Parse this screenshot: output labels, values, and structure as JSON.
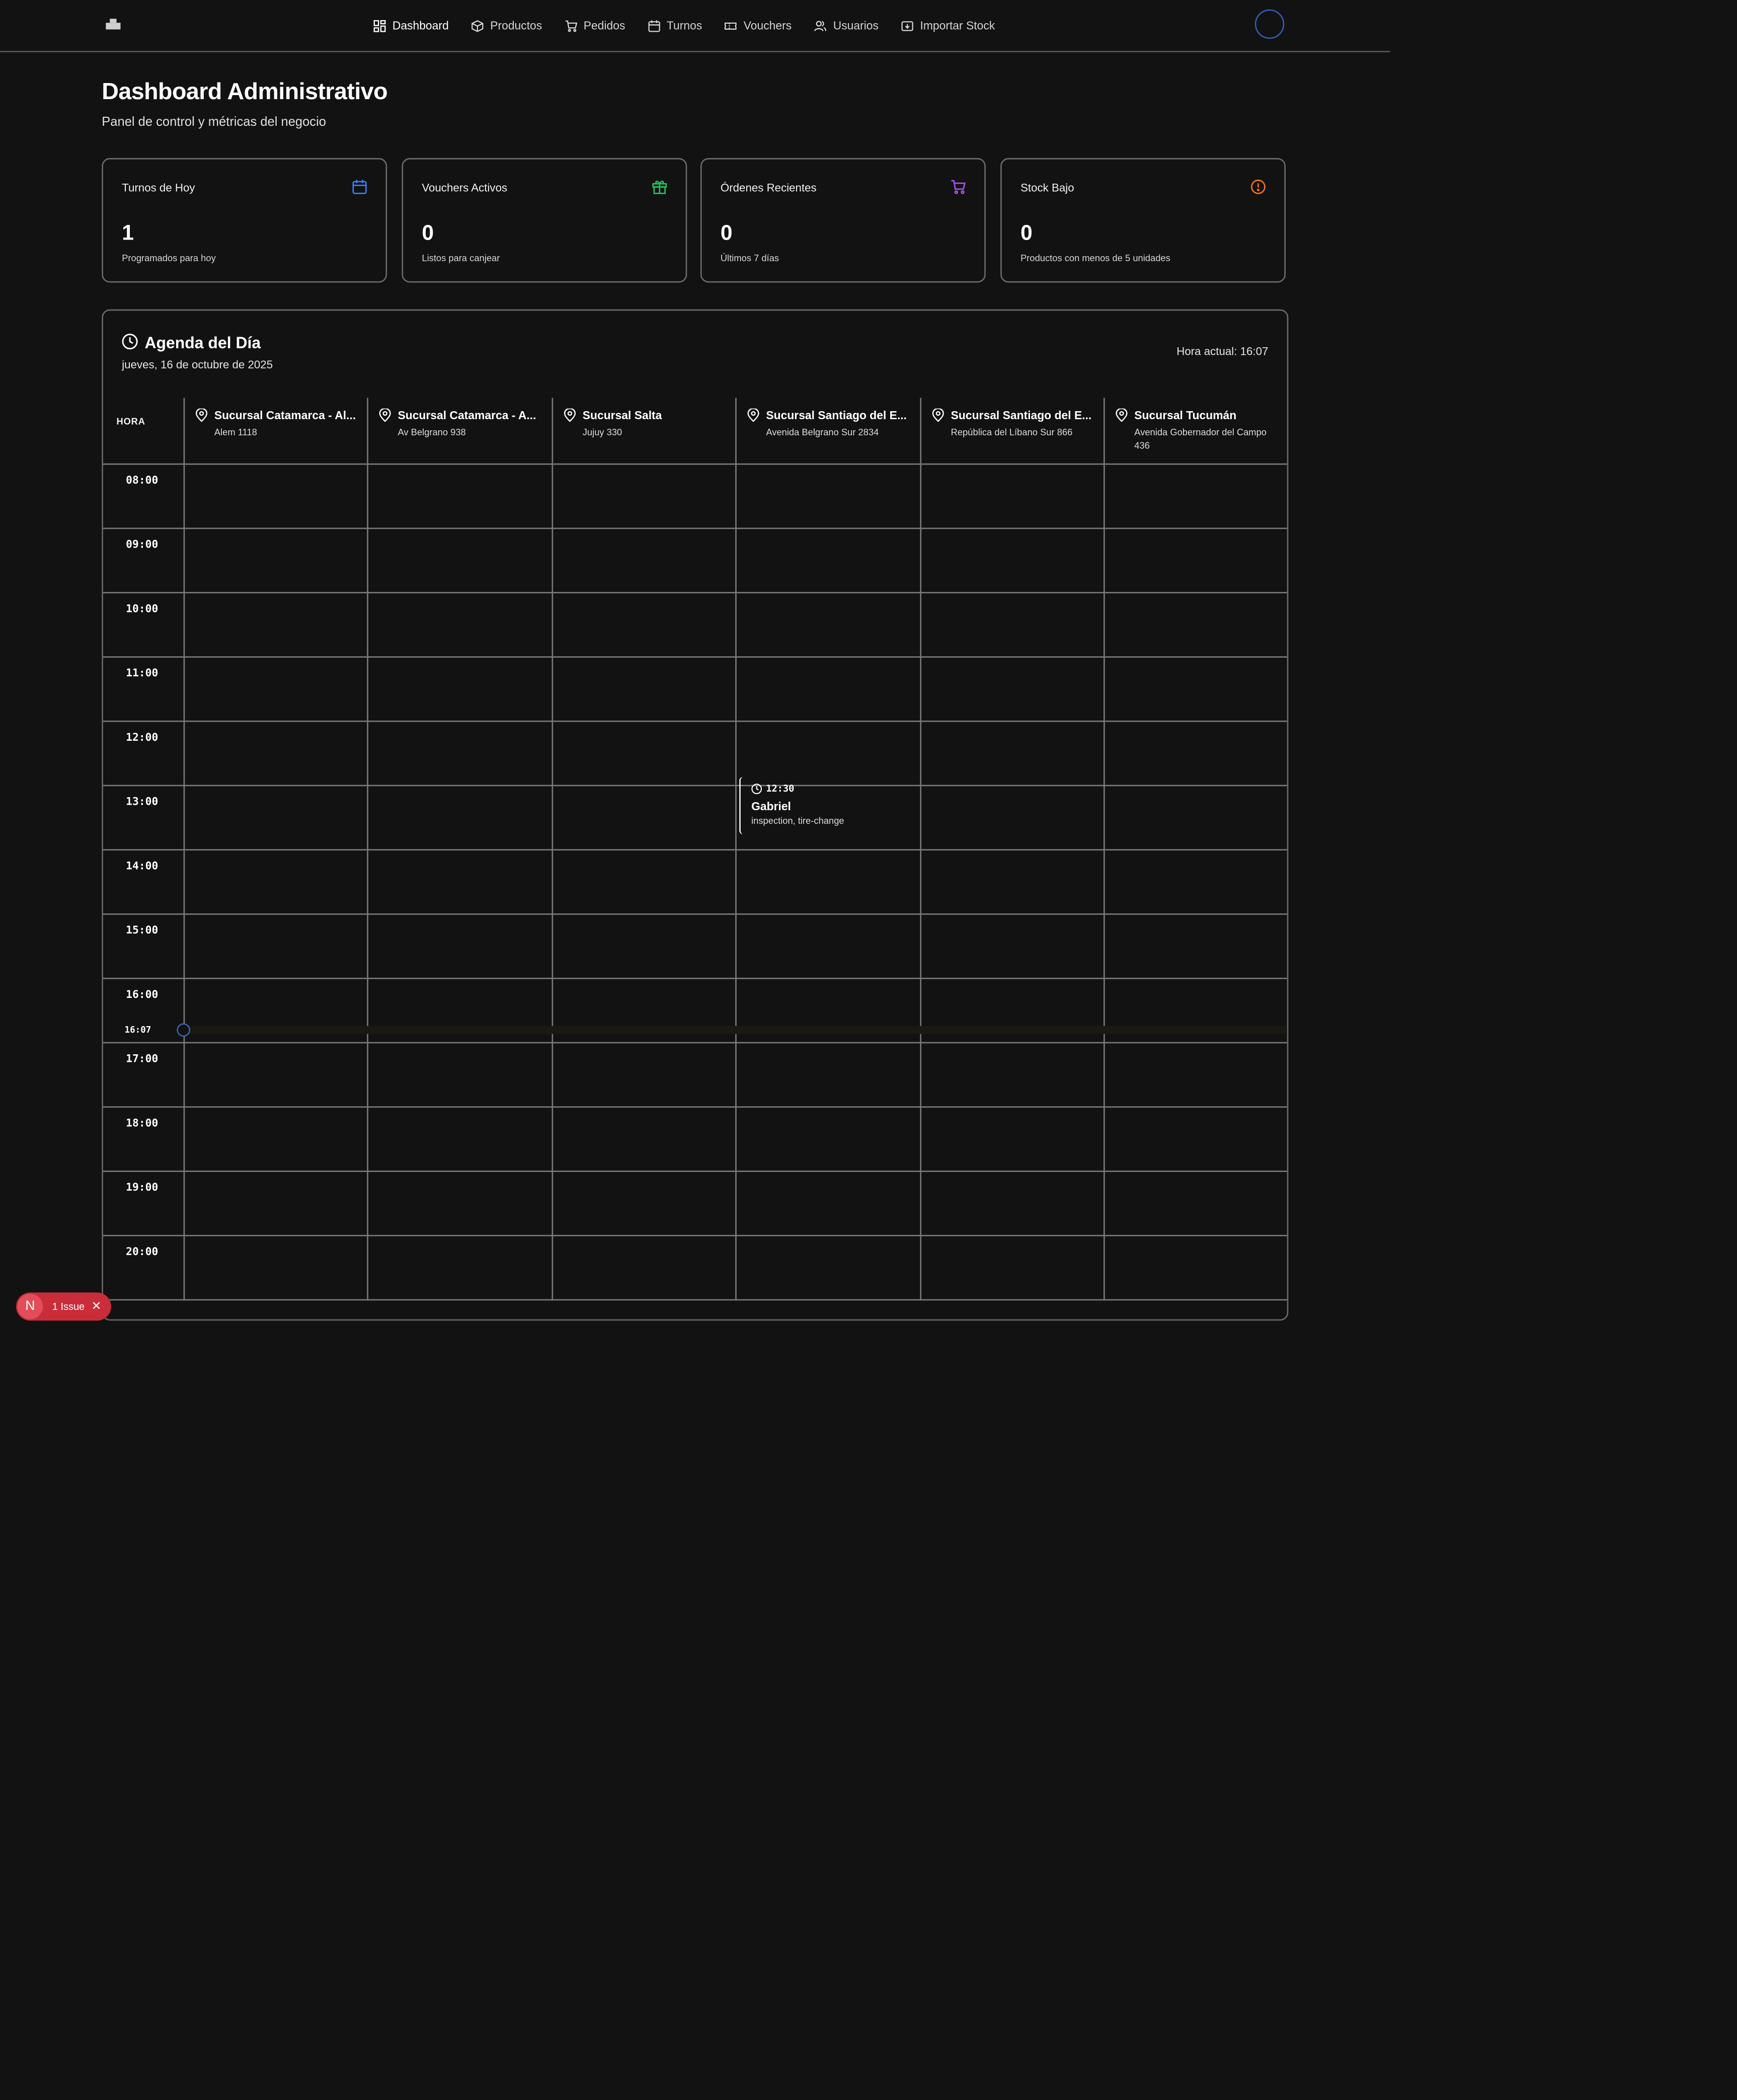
{
  "nav": {
    "items": [
      {
        "label": "Dashboard",
        "icon": "dashboard-icon",
        "active": true
      },
      {
        "label": "Productos",
        "icon": "box-icon"
      },
      {
        "label": "Pedidos",
        "icon": "cart-icon"
      },
      {
        "label": "Turnos",
        "icon": "calendar-icon"
      },
      {
        "label": "Vouchers",
        "icon": "ticket-icon"
      },
      {
        "label": "Usuarios",
        "icon": "users-icon"
      },
      {
        "label": "Importar Stock",
        "icon": "import-icon"
      }
    ]
  },
  "header": {
    "title": "Dashboard Administrativo",
    "subtitle": "Panel de control y métricas del negocio"
  },
  "cards": [
    {
      "title": "Turnos de Hoy",
      "value": "1",
      "desc": "Programados para hoy",
      "icon": "calendar-icon",
      "color": "#3b82f6"
    },
    {
      "title": "Vouchers Activos",
      "value": "0",
      "desc": "Listos para canjear",
      "icon": "gift-icon",
      "color": "#22c55e"
    },
    {
      "title": "Órdenes Recientes",
      "value": "0",
      "desc": "Últimos 7 días",
      "icon": "cart-icon",
      "color": "#a855f7"
    },
    {
      "title": "Stock Bajo",
      "value": "0",
      "desc": "Productos con menos de 5 unidades",
      "icon": "alert-icon",
      "color": "#f97316"
    }
  ],
  "agenda": {
    "title": "Agenda del Día",
    "date": "jueves, 16 de octubre de 2025",
    "current_time": "Hora actual: 16:07",
    "hora_label": "HORA",
    "branches": [
      {
        "name": "Sucursal Catamarca - Al...",
        "address": "Alem 1118"
      },
      {
        "name": "Sucursal Catamarca - A...",
        "address": "Av Belgrano 938"
      },
      {
        "name": "Sucursal Salta",
        "address": "Jujuy 330"
      },
      {
        "name": "Sucursal Santiago del E...",
        "address": "Avenida Belgrano Sur 2834"
      },
      {
        "name": "Sucursal Santiago del E...",
        "address": "República del Líbano Sur 866"
      },
      {
        "name": "Sucursal Tucumán",
        "address": "Avenida Gobernador del Campo 436"
      }
    ],
    "hours": [
      "08:00",
      "09:00",
      "10:00",
      "11:00",
      "12:00",
      "13:00",
      "14:00",
      "15:00",
      "16:00",
      "17:00",
      "18:00",
      "19:00",
      "20:00"
    ],
    "now_marker": "16:07",
    "appointment": {
      "time": "12:30",
      "name": "Gabriel",
      "services": "inspection, tire-change"
    }
  },
  "issue": {
    "badge": "N",
    "label": "1 Issue",
    "close": "✕"
  }
}
